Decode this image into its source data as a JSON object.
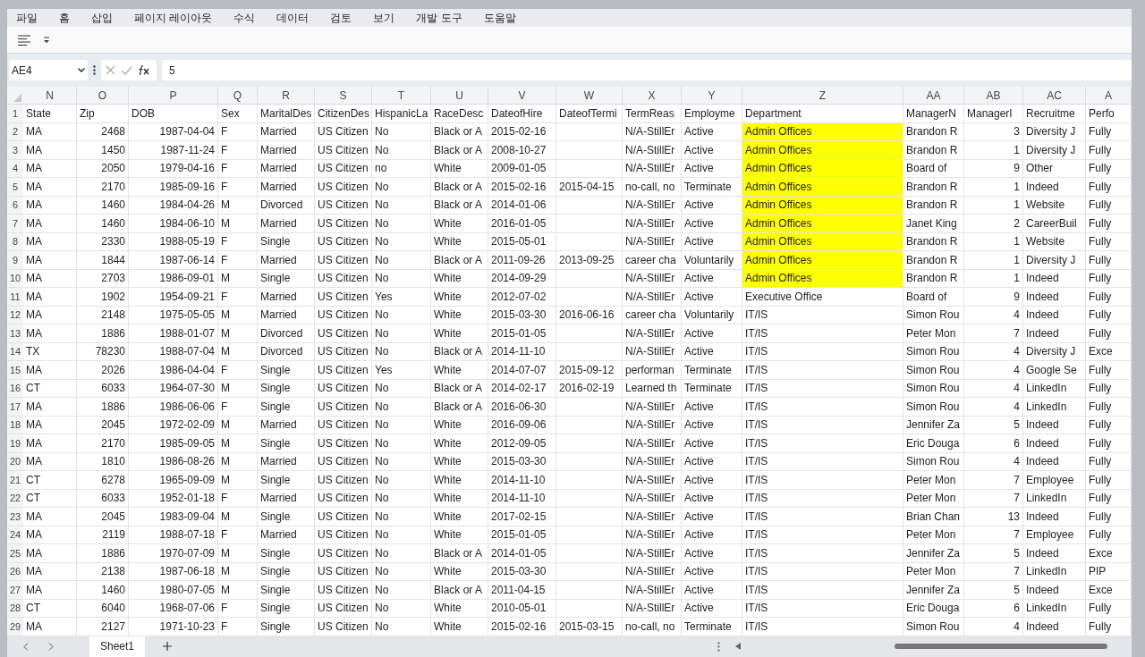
{
  "menu": [
    "파일",
    "홈",
    "삽입",
    "페이지 레이아웃",
    "수식",
    "데이터",
    "검토",
    "보기",
    "개발 도구",
    "도움말"
  ],
  "formula_bar": {
    "name_box": "AE4",
    "value": "5"
  },
  "columns": [
    {
      "label": "N",
      "numeric": false
    },
    {
      "label": "O",
      "numeric": true
    },
    {
      "label": "P",
      "numeric": true
    },
    {
      "label": "Q",
      "numeric": false
    },
    {
      "label": "R",
      "numeric": false
    },
    {
      "label": "S",
      "numeric": false
    },
    {
      "label": "T",
      "numeric": false
    },
    {
      "label": "U",
      "numeric": false
    },
    {
      "label": "V",
      "numeric": false
    },
    {
      "label": "W",
      "numeric": false
    },
    {
      "label": "X",
      "numeric": false
    },
    {
      "label": "Y",
      "numeric": false
    },
    {
      "label": "Z",
      "numeric": false
    },
    {
      "label": "AA",
      "numeric": false
    },
    {
      "label": "AB",
      "numeric": true
    },
    {
      "label": "AC",
      "numeric": false
    },
    {
      "label": "A",
      "numeric": false
    }
  ],
  "rows": [
    {
      "num": "1",
      "kind": "header",
      "department_highlighted": false,
      "cells": [
        "State",
        "Zip",
        "DOB",
        "Sex",
        "MaritalDes",
        "CitizenDes",
        "HispanicLa",
        "RaceDesc",
        "DateofHire",
        "DateofTermi",
        "TermReas",
        "Employme",
        "Department",
        "ManagerN",
        "ManagerI",
        "Recruitme",
        "Perfo"
      ]
    },
    {
      "num": "2",
      "kind": "data",
      "department_highlighted": true,
      "cells": [
        "MA",
        "2468",
        "1987-04-04",
        "F",
        "Married",
        "US Citizen",
        "No",
        "Black or A",
        "2015-02-16",
        null,
        "N/A-StillEr",
        "Active",
        "Admin Offices",
        "Brandon R",
        "3",
        "Diversity J",
        "Fully"
      ]
    },
    {
      "num": "3",
      "kind": "data",
      "department_highlighted": true,
      "cells": [
        "MA",
        "1450",
        "1987-11-24",
        "F",
        "Married",
        "US Citizen",
        "No",
        "Black or A",
        "2008-10-27",
        null,
        "N/A-StillEr",
        "Active",
        "Admin Offices",
        "Brandon R",
        "1",
        "Diversity J",
        "Fully"
      ]
    },
    {
      "num": "4",
      "kind": "data",
      "department_highlighted": true,
      "cells": [
        "MA",
        "2050",
        "1979-04-16",
        "F",
        "Married",
        "US Citizen",
        "no",
        "White",
        "2009-01-05",
        null,
        "N/A-StillEr",
        "Active",
        "Admin Offices",
        "Board of",
        "9",
        "Other",
        "Fully"
      ]
    },
    {
      "num": "5",
      "kind": "data",
      "department_highlighted": true,
      "cells": [
        "MA",
        "2170",
        "1985-09-16",
        "F",
        "Married",
        "US Citizen",
        "No",
        "Black or A",
        "2015-02-16",
        "2015-04-15",
        "no-call, no",
        "Terminate",
        "Admin Offices",
        "Brandon R",
        "1",
        "Indeed",
        "Fully"
      ]
    },
    {
      "num": "6",
      "kind": "data",
      "department_highlighted": true,
      "cells": [
        "MA",
        "1460",
        "1984-04-26",
        "M",
        "Divorced",
        "US Citizen",
        "No",
        "Black or A",
        "2014-01-06",
        null,
        "N/A-StillEr",
        "Active",
        "Admin Offices",
        "Brandon R",
        "1",
        "Website",
        "Fully"
      ]
    },
    {
      "num": "7",
      "kind": "data",
      "department_highlighted": true,
      "cells": [
        "MA",
        "1460",
        "1984-06-10",
        "M",
        "Married",
        "US Citizen",
        "No",
        "White",
        "2016-01-05",
        null,
        "N/A-StillEr",
        "Active",
        "Admin Offices",
        "Janet King",
        "2",
        "CareerBuil",
        "Fully"
      ]
    },
    {
      "num": "8",
      "kind": "data",
      "department_highlighted": true,
      "cells": [
        "MA",
        "2330",
        "1988-05-19",
        "F",
        "Single",
        "US Citizen",
        "No",
        "White",
        "2015-05-01",
        null,
        "N/A-StillEr",
        "Active",
        "Admin Offices",
        "Brandon R",
        "1",
        "Website",
        "Fully"
      ]
    },
    {
      "num": "9",
      "kind": "data",
      "department_highlighted": true,
      "cells": [
        "MA",
        "1844",
        "1987-06-14",
        "F",
        "Married",
        "US Citizen",
        "No",
        "Black or A",
        "2011-09-26",
        "2013-09-25",
        "career cha",
        "Voluntarily",
        "Admin Offices",
        "Brandon R",
        "1",
        "Diversity J",
        "Fully"
      ]
    },
    {
      "num": "10",
      "kind": "data",
      "department_highlighted": true,
      "cells": [
        "MA",
        "2703",
        "1986-09-01",
        "M",
        "Single",
        "US Citizen",
        "No",
        "White",
        "2014-09-29",
        null,
        "N/A-StillEr",
        "Active",
        "Admin Offices",
        "Brandon R",
        "1",
        "Indeed",
        "Fully"
      ]
    },
    {
      "num": "11",
      "kind": "data",
      "department_highlighted": false,
      "cells": [
        "MA",
        "1902",
        "1954-09-21",
        "F",
        "Married",
        "US Citizen",
        "Yes",
        "White",
        "2012-07-02",
        null,
        "N/A-StillEr",
        "Active",
        "Executive Office",
        "Board of",
        "9",
        "Indeed",
        "Fully"
      ]
    },
    {
      "num": "12",
      "kind": "data",
      "department_highlighted": false,
      "cells": [
        "MA",
        "2148",
        "1975-05-05",
        "M",
        "Married",
        "US Citizen",
        "No",
        "White",
        "2015-03-30",
        "2016-06-16",
        "career cha",
        "Voluntarily",
        "IT/IS",
        "Simon Rou",
        "4",
        "Indeed",
        "Fully"
      ]
    },
    {
      "num": "13",
      "kind": "data",
      "department_highlighted": false,
      "cells": [
        "MA",
        "1886",
        "1988-01-07",
        "M",
        "Divorced",
        "US Citizen",
        "No",
        "White",
        "2015-01-05",
        null,
        "N/A-StillEr",
        "Active",
        "IT/IS",
        "Peter Mon",
        "7",
        "Indeed",
        "Fully"
      ]
    },
    {
      "num": "14",
      "kind": "data",
      "department_highlighted": false,
      "cells": [
        "TX",
        "78230",
        "1988-07-04",
        "M",
        "Divorced",
        "US Citizen",
        "No",
        "Black or A",
        "2014-11-10",
        null,
        "N/A-StillEr",
        "Active",
        "IT/IS",
        "Simon Rou",
        "4",
        "Diversity J",
        "Exce"
      ]
    },
    {
      "num": "15",
      "kind": "data",
      "department_highlighted": false,
      "cells": [
        "MA",
        "2026",
        "1986-04-04",
        "F",
        "Single",
        "US Citizen",
        "Yes",
        "White",
        "2014-07-07",
        "2015-09-12",
        "performan",
        "Terminate",
        "IT/IS",
        "Simon Rou",
        "4",
        "Google Se",
        "Fully"
      ]
    },
    {
      "num": "16",
      "kind": "data",
      "department_highlighted": false,
      "cells": [
        "CT",
        "6033",
        "1964-07-30",
        "M",
        "Single",
        "US Citizen",
        "No",
        "Black or A",
        "2014-02-17",
        "2016-02-19",
        "Learned th",
        "Terminate",
        "IT/IS",
        "Simon Rou",
        "4",
        "LinkedIn",
        "Fully"
      ]
    },
    {
      "num": "17",
      "kind": "data",
      "department_highlighted": false,
      "cells": [
        "MA",
        "1886",
        "1986-06-06",
        "F",
        "Single",
        "US Citizen",
        "No",
        "Black or A",
        "2016-06-30",
        null,
        "N/A-StillEr",
        "Active",
        "IT/IS",
        "Simon Rou",
        "4",
        "LinkedIn",
        "Fully"
      ]
    },
    {
      "num": "18",
      "kind": "data",
      "department_highlighted": false,
      "cells": [
        "MA",
        "2045",
        "1972-02-09",
        "M",
        "Married",
        "US Citizen",
        "No",
        "White",
        "2016-09-06",
        null,
        "N/A-StillEr",
        "Active",
        "IT/IS",
        "Jennifer Za",
        "5",
        "Indeed",
        "Fully"
      ]
    },
    {
      "num": "19",
      "kind": "data",
      "department_highlighted": false,
      "cells": [
        "MA",
        "2170",
        "1985-09-05",
        "M",
        "Single",
        "US Citizen",
        "No",
        "White",
        "2012-09-05",
        null,
        "N/A-StillEr",
        "Active",
        "IT/IS",
        "Eric Douga",
        "6",
        "Indeed",
        "Fully"
      ]
    },
    {
      "num": "20",
      "kind": "data",
      "department_highlighted": false,
      "cells": [
        "MA",
        "1810",
        "1986-08-26",
        "M",
        "Married",
        "US Citizen",
        "No",
        "White",
        "2015-03-30",
        null,
        "N/A-StillEr",
        "Active",
        "IT/IS",
        "Simon Rou",
        "4",
        "Indeed",
        "Fully"
      ]
    },
    {
      "num": "21",
      "kind": "data",
      "department_highlighted": false,
      "cells": [
        "CT",
        "6278",
        "1965-09-09",
        "M",
        "Single",
        "US Citizen",
        "No",
        "White",
        "2014-11-10",
        null,
        "N/A-StillEr",
        "Active",
        "IT/IS",
        "Peter Mon",
        "7",
        "Employee",
        "Fully"
      ]
    },
    {
      "num": "22",
      "kind": "data",
      "department_highlighted": false,
      "cells": [
        "CT",
        "6033",
        "1952-01-18",
        "F",
        "Married",
        "US Citizen",
        "No",
        "White",
        "2014-11-10",
        null,
        "N/A-StillEr",
        "Active",
        "IT/IS",
        "Peter Mon",
        "7",
        "LinkedIn",
        "Fully"
      ]
    },
    {
      "num": "23",
      "kind": "data",
      "department_highlighted": false,
      "cells": [
        "MA",
        "2045",
        "1983-09-04",
        "M",
        "Single",
        "US Citizen",
        "No",
        "White",
        "2017-02-15",
        null,
        "N/A-StillEr",
        "Active",
        "IT/IS",
        "Brian Chan",
        "13",
        "Indeed",
        "Fully"
      ]
    },
    {
      "num": "24",
      "kind": "data",
      "department_highlighted": false,
      "cells": [
        "MA",
        "2119",
        "1988-07-18",
        "F",
        "Married",
        "US Citizen",
        "No",
        "White",
        "2015-01-05",
        null,
        "N/A-StillEr",
        "Active",
        "IT/IS",
        "Peter Mon",
        "7",
        "Employee",
        "Fully"
      ]
    },
    {
      "num": "25",
      "kind": "data",
      "department_highlighted": false,
      "cells": [
        "MA",
        "1886",
        "1970-07-09",
        "M",
        "Single",
        "US Citizen",
        "No",
        "Black or A",
        "2014-01-05",
        null,
        "N/A-StillEr",
        "Active",
        "IT/IS",
        "Jennifer Za",
        "5",
        "Indeed",
        "Exce"
      ]
    },
    {
      "num": "26",
      "kind": "data",
      "department_highlighted": false,
      "cells": [
        "MA",
        "2138",
        "1987-06-18",
        "M",
        "Single",
        "US Citizen",
        "No",
        "White",
        "2015-03-30",
        null,
        "N/A-StillEr",
        "Active",
        "IT/IS",
        "Peter Mon",
        "7",
        "LinkedIn",
        "PIP"
      ]
    },
    {
      "num": "27",
      "kind": "data",
      "department_highlighted": false,
      "cells": [
        "MA",
        "1460",
        "1980-07-05",
        "M",
        "Single",
        "US Citizen",
        "No",
        "Black or A",
        "2011-04-15",
        null,
        "N/A-StillEr",
        "Active",
        "IT/IS",
        "Jennifer Za",
        "5",
        "Indeed",
        "Exce"
      ]
    },
    {
      "num": "28",
      "kind": "data",
      "department_highlighted": false,
      "cells": [
        "CT",
        "6040",
        "1968-07-06",
        "F",
        "Single",
        "US Citizen",
        "No",
        "White",
        "2010-05-01",
        null,
        "N/A-StillEr",
        "Active",
        "IT/IS",
        "Eric Douga",
        "6",
        "LinkedIn",
        "Fully"
      ]
    },
    {
      "num": "29",
      "kind": "data",
      "department_highlighted": false,
      "cells": [
        "MA",
        "2127",
        "1971-10-23",
        "F",
        "Single",
        "US Citizen",
        "No",
        "White",
        "2015-02-16",
        "2015-03-15",
        "no-call, no",
        "Terminate",
        "IT/IS",
        "Simon Rou",
        "4",
        "Indeed",
        "Fully"
      ]
    }
  ],
  "sheet_tabs": [
    {
      "label": "Sheet1",
      "selected": true
    }
  ]
}
